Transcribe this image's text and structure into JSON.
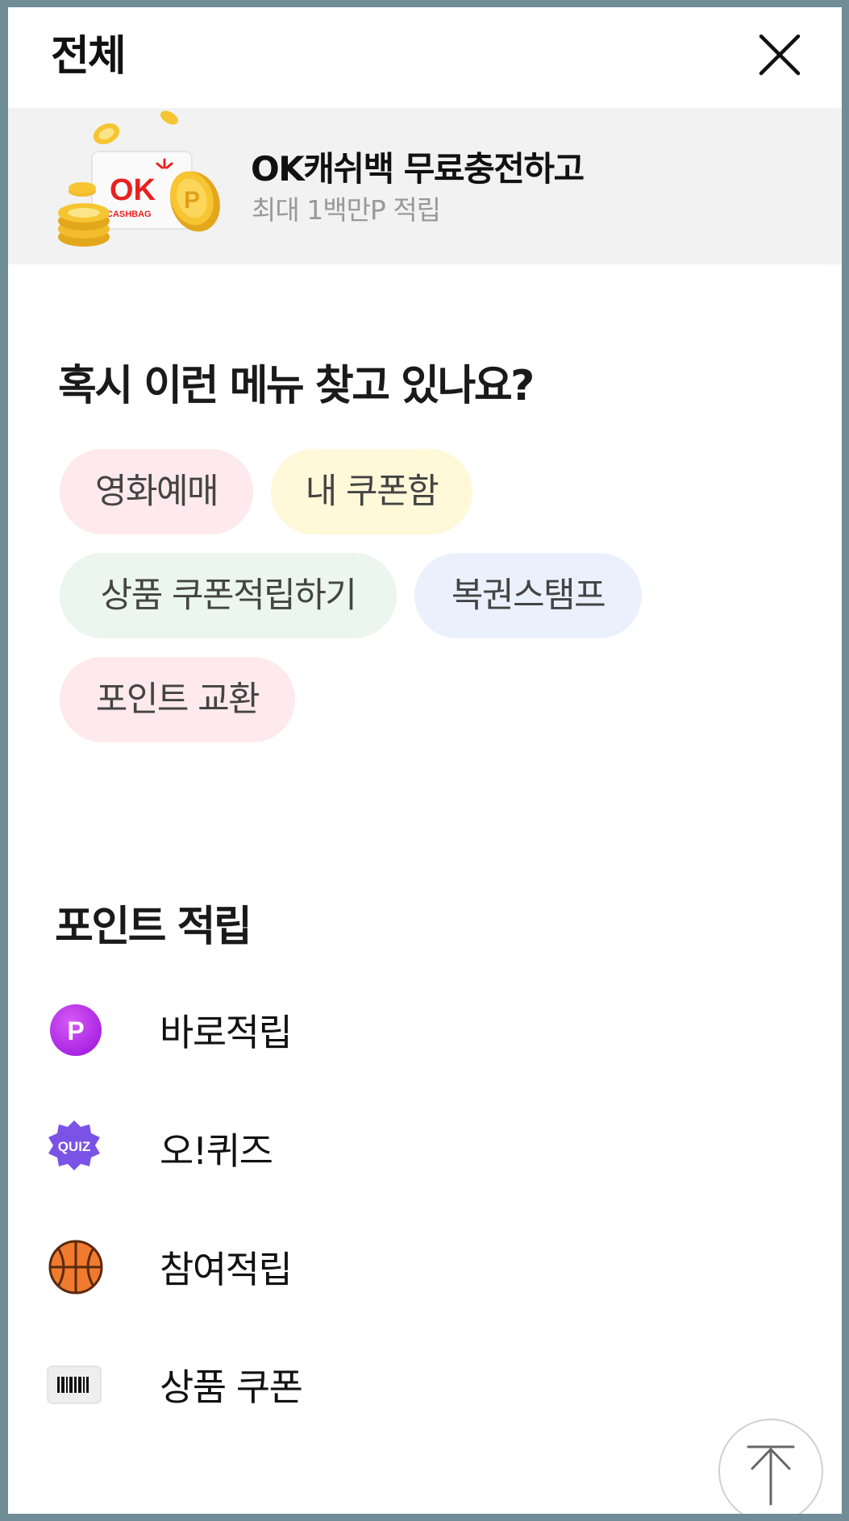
{
  "header": {
    "title": "전체",
    "close_icon": "close-icon"
  },
  "banner": {
    "title": "OK캐쉬백 무료충전하고",
    "subtitle": "최대 1백만P 적립",
    "card_logo": "OK",
    "card_logo_sub": "CASHBAG",
    "coin_mark": "P"
  },
  "suggest": {
    "title": "혹시 이런 메뉴 찾고 있나요?",
    "chips": [
      {
        "label": "영화예매",
        "color": "#fde9ee"
      },
      {
        "label": "내 쿠폰함",
        "color": "#fff8d9"
      },
      {
        "label": "상품 쿠폰적립하기",
        "color": "#ebf6ee"
      },
      {
        "label": "복권스탬프",
        "color": "#ebf1fc"
      },
      {
        "label": "포인트 교환",
        "color": "#fde9ee"
      }
    ]
  },
  "points": {
    "title": "포인트 적립",
    "items": [
      {
        "label": "바로적립",
        "icon": "p-coin-icon",
        "icon_text": "P"
      },
      {
        "label": "오!퀴즈",
        "icon": "quiz-badge-icon",
        "icon_text": "QUIZ"
      },
      {
        "label": "참여적립",
        "icon": "basketball-icon"
      },
      {
        "label": "상품 쿠폰",
        "icon": "barcode-icon"
      }
    ]
  },
  "scroll_top": {
    "icon": "arrow-up-icon"
  },
  "colors": {
    "background_frame": "#6f8c97",
    "banner_bg": "#f2f2f2",
    "p_coin": "#b52be8",
    "quiz_badge": "#7b52e6",
    "basketball": "#f07a2e"
  }
}
